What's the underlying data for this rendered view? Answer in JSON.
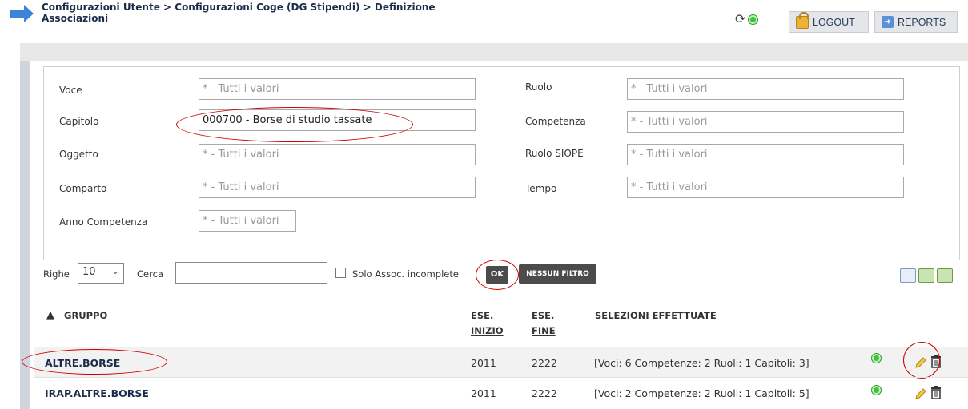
{
  "header": {
    "breadcrumb_line1": "Configurazioni Utente > Configurazioni Coge (DG Stipendi) > Definizione",
    "breadcrumb_line2": "Associazioni",
    "logout_label": "LOGOUT",
    "reports_label": "REPORTS"
  },
  "filters": {
    "voce": {
      "label": "Voce",
      "value": "* - Tutti i valori"
    },
    "capitolo": {
      "label": "Capitolo",
      "value": "000700 - Borse di studio tassate"
    },
    "oggetto": {
      "label": "Oggetto",
      "value": "* - Tutti i valori"
    },
    "comparto": {
      "label": "Comparto",
      "value": "* - Tutti i valori"
    },
    "anno": {
      "label": "Anno Competenza",
      "value": "* - Tutti i valori"
    },
    "ruolo": {
      "label": "Ruolo",
      "value": "* - Tutti i valori"
    },
    "competenza": {
      "label": "Competenza",
      "value": "* - Tutti i valori"
    },
    "ruolo_siope": {
      "label": "Ruolo SIOPE",
      "value": "* - Tutti i valori"
    },
    "tempo": {
      "label": "Tempo",
      "value": "* - Tutti i valori"
    }
  },
  "toolbar": {
    "righe_label": "Righe",
    "righe_value": "10",
    "cerca_label": "Cerca",
    "cerca_value": "",
    "solo_label": "Solo Assoc. incomplete",
    "ok_label": "OK",
    "nessun_label": "NESSUN FILTRO"
  },
  "table": {
    "sort_indicator": "▲",
    "col_gruppo": "GRUPPO",
    "col_inizio_1": "ESE.",
    "col_inizio_2": "INIZIO",
    "col_fine_1": "ESE.",
    "col_fine_2": "FINE",
    "col_selezioni": "SELEZIONI EFFETTUATE",
    "rows": [
      {
        "gruppo": "ALTRE.BORSE",
        "inizio": "2011",
        "fine": "2222",
        "selezioni": "[Voci: 6 Competenze: 2 Ruoli: 1 Capitoli: 3]"
      },
      {
        "gruppo": "IRAP.ALTRE.BORSE",
        "inizio": "2011",
        "fine": "2222",
        "selezioni": "[Voci: 2 Competenze: 2 Ruoli: 1 Capitoli: 5]"
      }
    ]
  },
  "colors": {
    "accent_blue": "#3a85d8",
    "dark_button": "#4b4b4b",
    "status_green": "#3cc43c",
    "annotation_red": "#cc0000"
  }
}
